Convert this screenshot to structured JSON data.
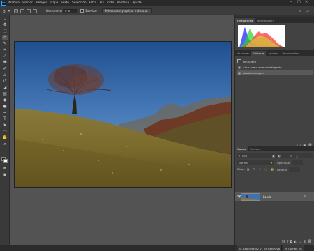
{
  "menu": {
    "logo": "Ps",
    "items": [
      "Archivo",
      "Edición",
      "Imagen",
      "Capa",
      "Texto",
      "Selección",
      "Filtro",
      "3D",
      "Vista",
      "Ventana",
      "Ayuda"
    ]
  },
  "options": {
    "feather_label": "Desvanecer:",
    "feather_value": "0 px",
    "antialias_label": "Suavizar",
    "select_mask_label": "Seleccionar y aplicar máscara..."
  },
  "panels": {
    "histogram_tab": "Histograma",
    "info_tab": "Información",
    "history_tabs": [
      "Acciones",
      "Historia",
      "Ajustes",
      "Propiedades"
    ],
    "history_snapshot": "DSC0-993",
    "history_items": [
      "Abrir como objeto inteligente",
      "Acoplar imagen"
    ],
    "layers_tabs": [
      "Capas",
      "Canales"
    ],
    "kind_label": "Tipo",
    "blend_mode": "Normal",
    "opacity_label": "Opacidad:",
    "lock_label": "Bloq.:",
    "fill_label": "Relleno:",
    "layer_name": "Fondo"
  },
  "bottom_tabs": [
    "TK RapidMask2 V6",
    "TK Batch V6",
    "TK Combo V6"
  ],
  "colors": {
    "foreground": "#1a1a1a",
    "background": "#ffffff",
    "accent_blue": "#31a8ff"
  }
}
